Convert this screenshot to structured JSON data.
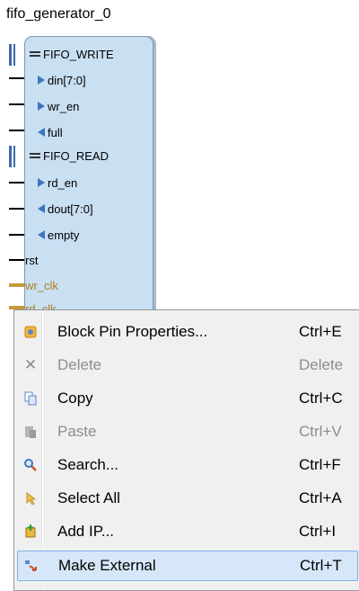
{
  "block": {
    "title": "fifo_generator_0",
    "rows": [
      {
        "label": "FIFO_WRITE"
      },
      {
        "label": "din[7:0]"
      },
      {
        "label": "wr_en"
      },
      {
        "label": "full"
      },
      {
        "label": "FIFO_READ"
      },
      {
        "label": "rd_en"
      },
      {
        "label": "dout[7:0]"
      },
      {
        "label": "empty"
      },
      {
        "label": "rst"
      },
      {
        "label": "wr_clk"
      },
      {
        "label": "rd_clk"
      }
    ]
  },
  "menu": {
    "items": [
      {
        "label": "Block Pin Properties...",
        "shortcut": "Ctrl+E",
        "icon": "block-pin-properties-icon"
      },
      {
        "label": "Delete",
        "shortcut": "Delete",
        "icon": "delete-icon",
        "disabled": true
      },
      {
        "label": "Copy",
        "shortcut": "Ctrl+C",
        "icon": "copy-icon"
      },
      {
        "label": "Paste",
        "shortcut": "Ctrl+V",
        "icon": "paste-icon",
        "disabled": true
      },
      {
        "label": "Search...",
        "shortcut": "Ctrl+F",
        "icon": "search-icon"
      },
      {
        "label": "Select All",
        "shortcut": "Ctrl+A",
        "icon": "select-all-icon"
      },
      {
        "label": "Add IP...",
        "shortcut": "Ctrl+I",
        "icon": "add-ip-icon"
      },
      {
        "label": "Make External",
        "shortcut": "Ctrl+T",
        "icon": "make-external-icon",
        "highlighted": true
      }
    ]
  },
  "colors": {
    "block_fill": "#c9dff2",
    "bus": "#3e6aa8",
    "clock": "#c69a3b",
    "menu_bg": "#f0f0f0",
    "highlight": "#d5e7f8"
  }
}
